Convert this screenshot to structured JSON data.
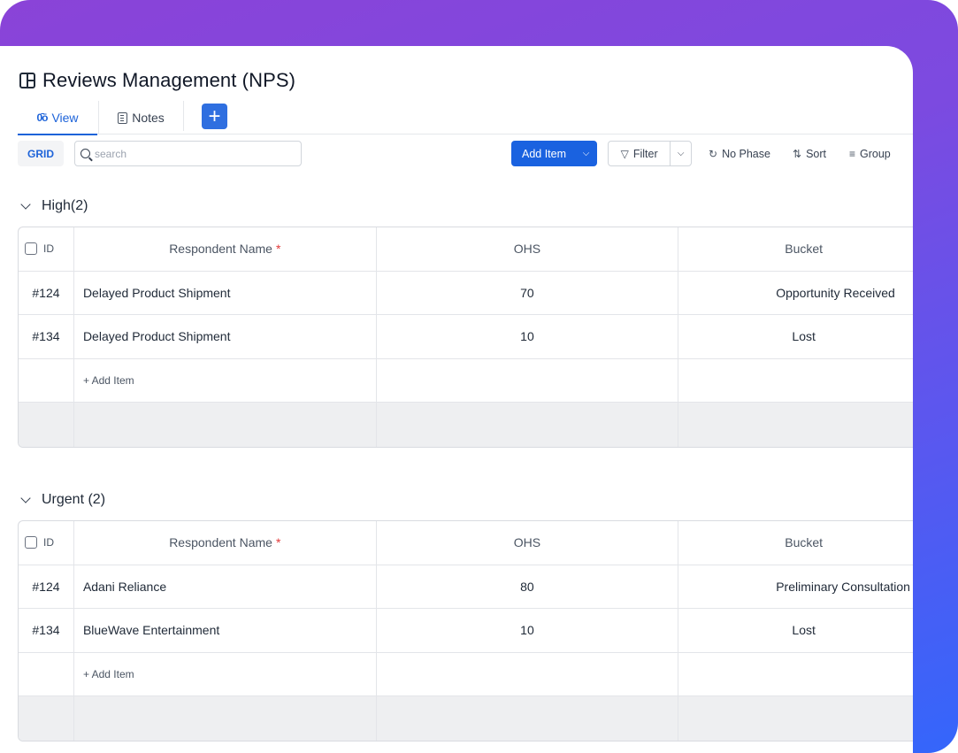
{
  "page": {
    "title": "Reviews Management (NPS)",
    "title_icon": "table-layout-icon"
  },
  "tabs": [
    {
      "label": "View",
      "icon": "view-columns-icon",
      "active": true
    },
    {
      "label": "Notes",
      "icon": "notes-icon",
      "active": false
    }
  ],
  "add_tab_label": "+",
  "toolbar": {
    "view_mode": "GRID",
    "search_placeholder": "search",
    "search_value": "",
    "add_item_label": "Add Item",
    "filter_label": "Filter",
    "phase_label": "No Phase",
    "sort_label": "Sort",
    "group_label": "Group"
  },
  "columns": {
    "id": "ID",
    "name": "Respondent Name",
    "required_mark": "*",
    "ohs": "OHS",
    "bucket": "Bucket"
  },
  "add_row_label": "+ Add Item",
  "groups": [
    {
      "label": "High(2)",
      "rows": [
        {
          "id": "#124",
          "name": "Delayed Product Shipment",
          "ohs": "70",
          "bucket": "Opportunity Received"
        },
        {
          "id": "#134",
          "name": "Delayed Product Shipment",
          "ohs": "10",
          "bucket": "Lost"
        }
      ]
    },
    {
      "label": "Urgent (2)",
      "rows": [
        {
          "id": "#124",
          "name": "Adani Reliance",
          "ohs": "80",
          "bucket": "Preliminary Consultation"
        },
        {
          "id": "#134",
          "name": "BlueWave Entertainment",
          "ohs": "10",
          "bucket": "Lost"
        }
      ]
    }
  ],
  "colors": {
    "accent": "#1a62e0",
    "gradient_start": "#8a43d8",
    "gradient_end": "#3466fb",
    "required": "#e23a3a"
  }
}
